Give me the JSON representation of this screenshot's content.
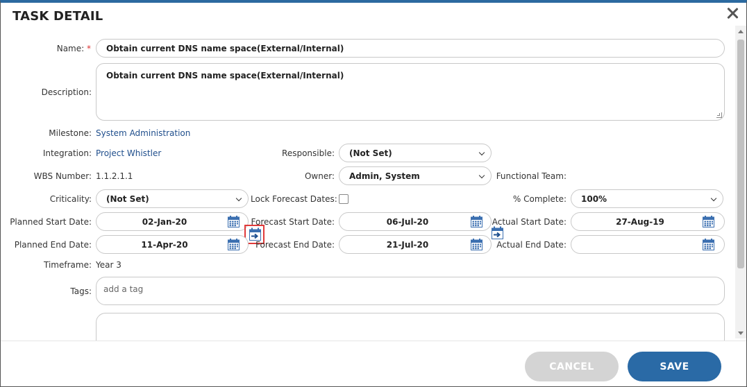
{
  "dialog": {
    "title": "TASK DETAIL"
  },
  "fields": {
    "name": {
      "label": "Name:",
      "required_mark": "*",
      "value": "Obtain current DNS name space(External/Internal)"
    },
    "description": {
      "label": "Description:",
      "value": "Obtain current DNS name space(External/Internal)"
    },
    "milestone": {
      "label": "Milestone:",
      "value": "System Administration"
    },
    "integration": {
      "label": "Integration:",
      "value": "Project Whistler"
    },
    "responsible": {
      "label": "Responsible:",
      "value": "(Not Set)"
    },
    "wbs_number": {
      "label": "WBS Number:",
      "value": "1.1.2.1.1"
    },
    "owner": {
      "label": "Owner:",
      "value": "Admin, System"
    },
    "functional_team": {
      "label": "Functional Team:",
      "value": ""
    },
    "criticality": {
      "label": "Criticality:",
      "value": "(Not Set)"
    },
    "lock_forecast_dates": {
      "label": "Lock Forecast Dates:",
      "checked": false
    },
    "percent_complete": {
      "label": "% Complete:",
      "value": "100%"
    },
    "planned_start": {
      "label": "Planned Start Date:",
      "value": "02-Jan-20"
    },
    "forecast_start": {
      "label": "Forecast Start Date:",
      "value": "06-Jul-20"
    },
    "actual_start": {
      "label": "Actual Start Date:",
      "value": "27-Aug-19"
    },
    "planned_end": {
      "label": "Planned End Date:",
      "value": "11-Apr-20"
    },
    "forecast_end": {
      "label": "Forecast End Date:",
      "value": "21-Jul-20"
    },
    "actual_end": {
      "label": "Actual End Date:",
      "value": ""
    },
    "timeframe": {
      "label": "Timeframe:",
      "value": "Year 3"
    },
    "tags": {
      "label": "Tags:",
      "placeholder": "add a tag"
    }
  },
  "buttons": {
    "cancel": "CANCEL",
    "save": "SAVE"
  },
  "icons": {
    "close": "close-icon",
    "calendar": "calendar-icon",
    "copy_dates": "copy-dates-icon"
  },
  "colors": {
    "accent": "#2a6aa6",
    "link": "#1f4e8c",
    "required": "#dd3333",
    "highlight": "#e03a3a"
  }
}
